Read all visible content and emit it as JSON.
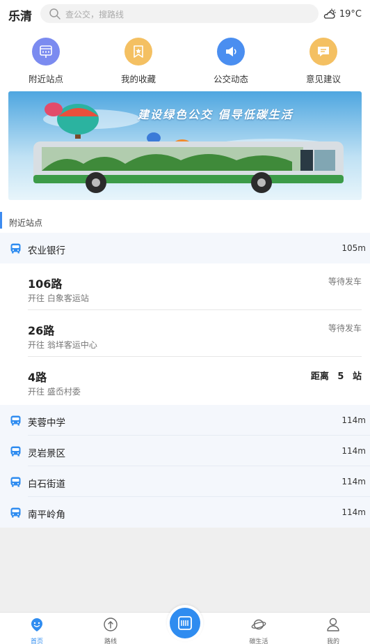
{
  "header": {
    "city": "乐清",
    "search_placeholder": "查公交，搜路线",
    "temperature": "19°C"
  },
  "quick_actions": [
    {
      "label": "附近站点",
      "icon": "nearby-station-icon",
      "color": "#7b8bf0"
    },
    {
      "label": "我的收藏",
      "icon": "favorite-icon",
      "color": "#f4c062"
    },
    {
      "label": "公交动态",
      "icon": "broadcast-icon",
      "color": "#4a8ef0"
    },
    {
      "label": "意见建议",
      "icon": "feedback-icon",
      "color": "#f4c062"
    }
  ],
  "banner": {
    "text": "建设绿色公交 倡导低碳生活"
  },
  "nearby": {
    "section_title": "附近站点",
    "stations": [
      {
        "name": "农业银行",
        "distance": "105m"
      },
      {
        "name": "芙蓉中学",
        "distance": "114m"
      },
      {
        "name": "灵岩景区",
        "distance": "114m"
      },
      {
        "name": "白石街道",
        "distance": "114m"
      },
      {
        "name": "南平岭角",
        "distance": "114m"
      }
    ],
    "routes": [
      {
        "name": "106路",
        "direction": "开往 白象客运站",
        "status": "等待发车"
      },
      {
        "name": "26路",
        "direction": "开往 翁垟客运中心",
        "status": "等待发车"
      },
      {
        "name": "4路",
        "direction": "开往 盛岙村委",
        "status": "距离 5 站"
      }
    ]
  },
  "tabs": [
    {
      "label": "首页",
      "icon": "home-icon",
      "active": true
    },
    {
      "label": "路线",
      "icon": "route-icon",
      "active": false
    },
    {
      "label": "碳生活",
      "icon": "planet-icon",
      "active": false
    },
    {
      "label": "我的",
      "icon": "user-icon",
      "active": false
    }
  ],
  "colors": {
    "accent": "#2f8cf0",
    "station_bg": "#f4f7fc"
  }
}
